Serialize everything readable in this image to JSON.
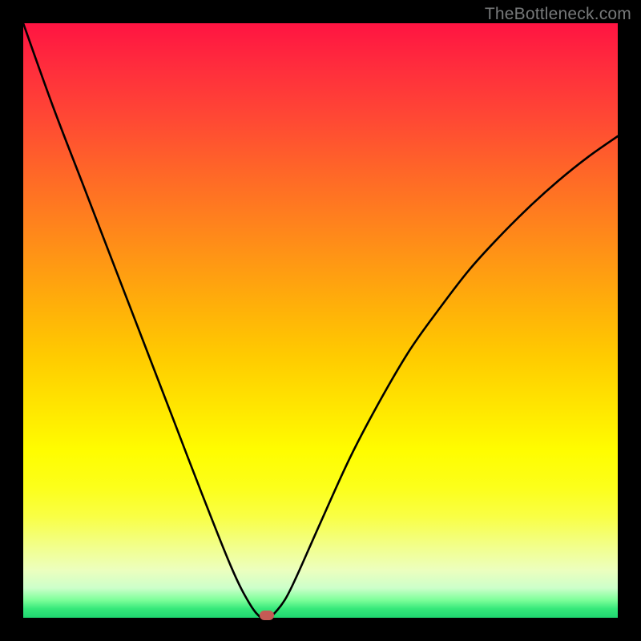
{
  "watermark": "TheBottleneck.com",
  "chart_data": {
    "type": "line",
    "title": "",
    "xlabel": "",
    "ylabel": "",
    "xlim": [
      0,
      100
    ],
    "ylim": [
      0,
      100
    ],
    "grid": false,
    "legend": false,
    "series": [
      {
        "name": "bottleneck-curve",
        "x": [
          0,
          5,
          10,
          15,
          20,
          25,
          30,
          35,
          38,
          40,
          41,
          42,
          44,
          46,
          50,
          55,
          60,
          65,
          70,
          75,
          80,
          85,
          90,
          95,
          100
        ],
        "y": [
          100,
          86,
          73,
          60,
          47,
          34,
          21,
          8.5,
          2.5,
          0,
          0,
          0.5,
          3,
          7,
          16,
          27,
          36.5,
          45,
          52,
          58.5,
          64,
          69,
          73.5,
          77.5,
          81
        ]
      }
    ],
    "marker": {
      "x": 41,
      "y": 0.4
    },
    "gradient_stops": [
      {
        "pos": 0,
        "color": "#ff1442"
      },
      {
        "pos": 8,
        "color": "#ff2f3c"
      },
      {
        "pos": 16,
        "color": "#ff4834"
      },
      {
        "pos": 24,
        "color": "#ff6329"
      },
      {
        "pos": 32,
        "color": "#ff7d1f"
      },
      {
        "pos": 40,
        "color": "#ff9714"
      },
      {
        "pos": 48,
        "color": "#ffb109"
      },
      {
        "pos": 56,
        "color": "#ffcb00"
      },
      {
        "pos": 64,
        "color": "#ffe400"
      },
      {
        "pos": 72,
        "color": "#fffd00"
      },
      {
        "pos": 78,
        "color": "#fcff1a"
      },
      {
        "pos": 83,
        "color": "#f9ff45"
      },
      {
        "pos": 88,
        "color": "#f2ff8b"
      },
      {
        "pos": 92,
        "color": "#ecffbe"
      },
      {
        "pos": 95,
        "color": "#ccffca"
      },
      {
        "pos": 97,
        "color": "#7eff9a"
      },
      {
        "pos": 98.5,
        "color": "#35e87a"
      },
      {
        "pos": 100,
        "color": "#1fd670"
      }
    ]
  }
}
